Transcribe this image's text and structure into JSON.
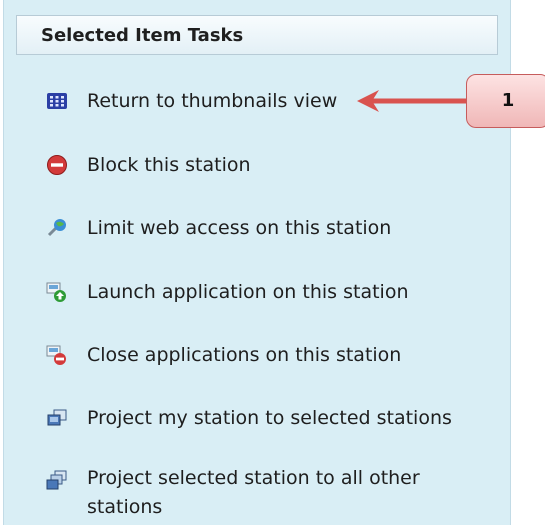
{
  "panel": {
    "title": "Selected Item Tasks",
    "items": [
      {
        "label": "Return to thumbnails view",
        "icon": "thumbnails-grid-icon"
      },
      {
        "label": "Block this station",
        "icon": "block-icon"
      },
      {
        "label": "Limit web access on this station",
        "icon": "web-access-icon"
      },
      {
        "label": "Launch application on this station",
        "icon": "launch-app-icon"
      },
      {
        "label": "Close applications on this station",
        "icon": "close-app-icon"
      },
      {
        "label": "Project my station to selected stations",
        "icon": "project-station-icon"
      },
      {
        "label": "Project selected station to all other stations",
        "icon": "project-all-icon"
      }
    ]
  },
  "callout": {
    "number": "1",
    "color": "#d9534f"
  },
  "colors": {
    "panel_bg": "#d9eef5",
    "arrow": "#d9534f"
  }
}
